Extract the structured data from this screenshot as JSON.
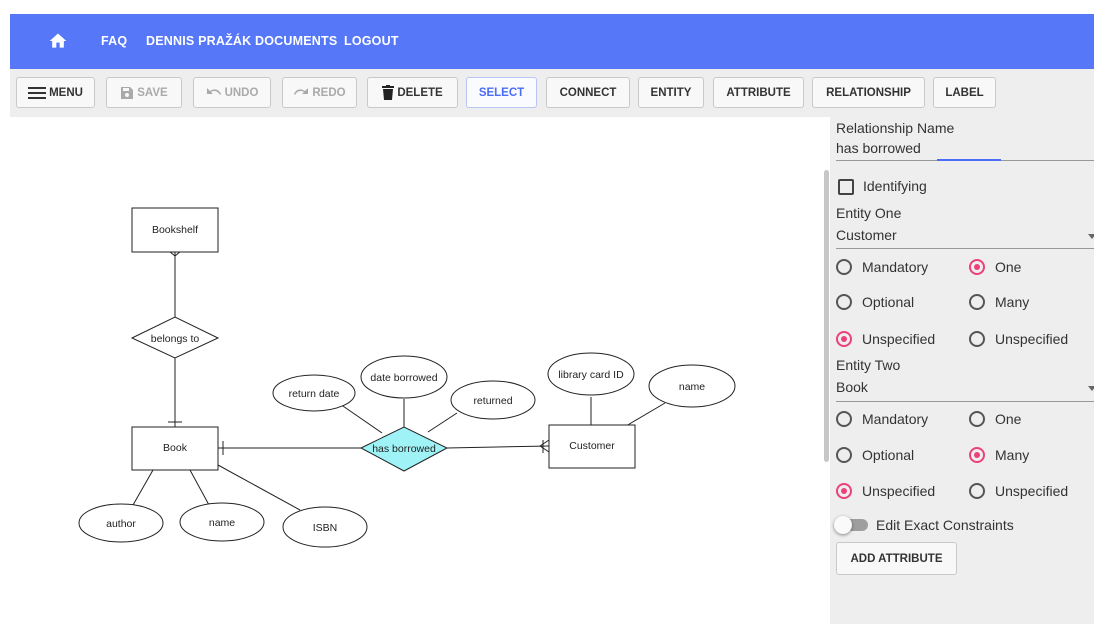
{
  "navbar": {
    "links": [
      "FAQ",
      "DENNIS PRAŽÁK",
      "DOCUMENTS",
      "LOGOUT"
    ]
  },
  "toolbar": {
    "menu": "MENU",
    "save": "SAVE",
    "undo": "UNDO",
    "redo": "REDO",
    "delete": "DELETE",
    "select": "SELECT",
    "connect": "CONNECT",
    "entity": "ENTITY",
    "attribute": "ATTRIBUTE",
    "relationship": "RELATIONSHIP",
    "label": "LABEL"
  },
  "diagram": {
    "entities": [
      "Bookshelf",
      "Book",
      "Customer"
    ],
    "relationships": [
      "belongs to",
      "has borrowed"
    ],
    "attributes": [
      "return date",
      "date borrowed",
      "returned",
      "library card ID",
      "name",
      "author",
      "name",
      "ISBN"
    ]
  },
  "panel": {
    "relationship_name_label": "Relationship Name",
    "relationship_name_value": "has borrowed",
    "identifying_label": "Identifying",
    "identifying_checked": false,
    "entity_one_label": "Entity One",
    "entity_one_value": "Customer",
    "entity_two_label": "Entity Two",
    "entity_two_value": "Book",
    "opt_mandatory": "Mandatory",
    "opt_optional": "Optional",
    "opt_unspecified": "Unspecified",
    "opt_one": "One",
    "opt_many": "Many",
    "entity_one_participation": "Unspecified",
    "entity_one_cardinality": "One",
    "entity_two_participation": "Unspecified",
    "entity_two_cardinality": "Many",
    "edit_exact_label": "Edit Exact Constraints",
    "edit_exact_on": false,
    "add_attribute": "ADD ATTRIBUTE"
  },
  "colors": {
    "navbar": "#5577f8",
    "accent": "#4a6cf7",
    "radio_selected": "#ec407a",
    "selected_relationship_fill": "#9ff3f6"
  }
}
